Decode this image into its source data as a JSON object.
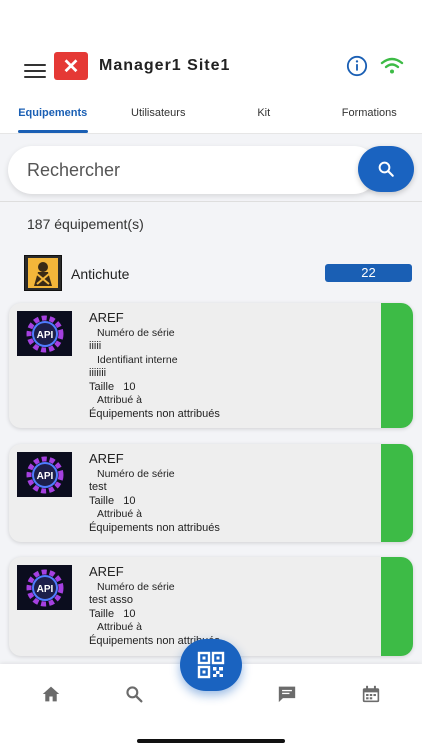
{
  "header": {
    "title": "Manager1 Site1",
    "menu_icon": "hamburger-menu-icon",
    "logo_icon": "close-x-icon",
    "info_icon": "info-icon",
    "wifi_icon": "wifi-icon"
  },
  "tabs": [
    {
      "label": "Equipements",
      "active": true
    },
    {
      "label": "Utilisateurs",
      "active": false
    },
    {
      "label": "Kit",
      "active": false
    },
    {
      "label": "Formations",
      "active": false
    }
  ],
  "search": {
    "placeholder": "Rechercher"
  },
  "count_text": "187 équipement(s)",
  "category": {
    "label": "Antichute",
    "count": "22"
  },
  "cards": [
    {
      "name": "AREF",
      "serial_label": "Numéro de série",
      "serial_value": "iiiii",
      "internal_label": "Identifiant interne",
      "internal_value": "iiiiiii",
      "size_label": "Taille",
      "size_value": "10",
      "assigned_label": "Attribué à",
      "assigned_value": "Équipements non attribués"
    },
    {
      "name": "AREF",
      "serial_label": "Numéro de série",
      "serial_value": "test",
      "size_label": "Taille",
      "size_value": "10",
      "assigned_label": "Attribué à",
      "assigned_value": "Équipements non attribués"
    },
    {
      "name": "AREF",
      "serial_label": "Numéro de série",
      "serial_value": "test asso",
      "size_label": "Taille",
      "size_value": "10",
      "assigned_label": "Attribué à",
      "assigned_value": "Équipements non attribués"
    }
  ],
  "colors": {
    "accent": "#1a5fb4",
    "status_green": "#3dbb46",
    "logo_red": "#e53935"
  },
  "bottom_nav": [
    "home-icon",
    "search-icon",
    "qr-code-icon",
    "chat-icon",
    "calendar-icon"
  ]
}
